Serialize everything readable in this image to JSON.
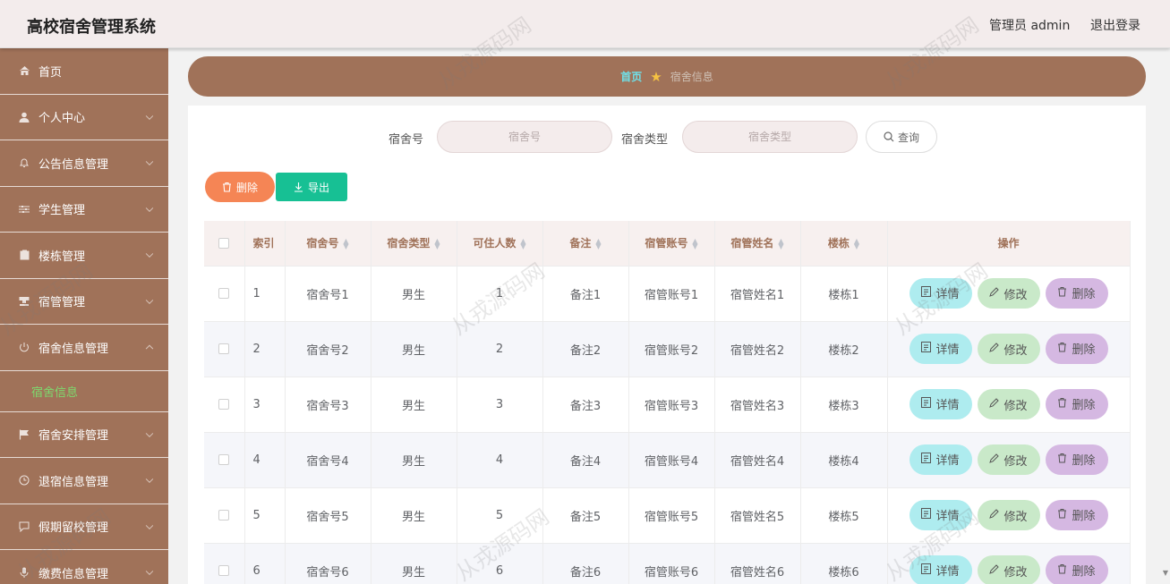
{
  "header": {
    "app_title": "高校宿舍管理系统",
    "user_label": "管理员 admin",
    "logout_label": "退出登录"
  },
  "sidebar": {
    "items": [
      {
        "label": "首页",
        "icon": "home-icon",
        "expandable": false
      },
      {
        "label": "个人中心",
        "icon": "user-icon",
        "expandable": true
      },
      {
        "label": "公告信息管理",
        "icon": "bell-icon",
        "expandable": true
      },
      {
        "label": "学生管理",
        "icon": "sliders-icon",
        "expandable": true
      },
      {
        "label": "楼栋管理",
        "icon": "clipboard-icon",
        "expandable": true
      },
      {
        "label": "宿管管理",
        "icon": "stamp-icon",
        "expandable": true
      },
      {
        "label": "宿舍信息管理",
        "icon": "power-icon",
        "expandable": true,
        "expanded": true
      },
      {
        "label": "宿舍安排管理",
        "icon": "flag-icon",
        "expandable": true
      },
      {
        "label": "退宿信息管理",
        "icon": "clock-icon",
        "expandable": true
      },
      {
        "label": "假期留校管理",
        "icon": "chat-icon",
        "expandable": true
      },
      {
        "label": "缴费信息管理",
        "icon": "mic-icon",
        "expandable": true
      }
    ],
    "active_sub_item": "宿舍信息"
  },
  "breadcrumb": {
    "home": "首页",
    "current": "宿舍信息"
  },
  "search": {
    "dorm_no_label": "宿舍号",
    "dorm_no_placeholder": "宿舍号",
    "dorm_type_label": "宿舍类型",
    "dorm_type_placeholder": "宿舍类型",
    "query_label": "查询"
  },
  "toolbar": {
    "delete_label": "删除",
    "export_label": "导出"
  },
  "table": {
    "headers": [
      "索引",
      "宿舍号",
      "宿舍类型",
      "可住人数",
      "备注",
      "宿管账号",
      "宿管姓名",
      "楼栋",
      "操作"
    ],
    "rows": [
      [
        "1",
        "宿舍号1",
        "男生",
        "1",
        "备注1",
        "宿管账号1",
        "宿管姓名1",
        "楼栋1"
      ],
      [
        "2",
        "宿舍号2",
        "男生",
        "2",
        "备注2",
        "宿管账号2",
        "宿管姓名2",
        "楼栋2"
      ],
      [
        "3",
        "宿舍号3",
        "男生",
        "3",
        "备注3",
        "宿管账号3",
        "宿管姓名3",
        "楼栋3"
      ],
      [
        "4",
        "宿舍号4",
        "男生",
        "4",
        "备注4",
        "宿管账号4",
        "宿管姓名4",
        "楼栋4"
      ],
      [
        "5",
        "宿舍号5",
        "男生",
        "5",
        "备注5",
        "宿管账号5",
        "宿管姓名5",
        "楼栋5"
      ],
      [
        "6",
        "宿舍号6",
        "男生",
        "6",
        "备注6",
        "宿管账号6",
        "宿管姓名6",
        "楼栋6"
      ]
    ],
    "actions": {
      "detail": "详情",
      "edit": "修改",
      "delete": "删除"
    }
  },
  "watermark": "从戎源码网",
  "colors": {
    "primary_brown": "#a07259",
    "header_bg": "#f3ecec",
    "active_sub_text": "#7ddb6e",
    "delete_orange": "#f58555",
    "export_green": "#17c094",
    "detail_bg": "#aeecef",
    "edit_bg": "#c9e9c9",
    "delete_bg": "#d5b8e2"
  }
}
